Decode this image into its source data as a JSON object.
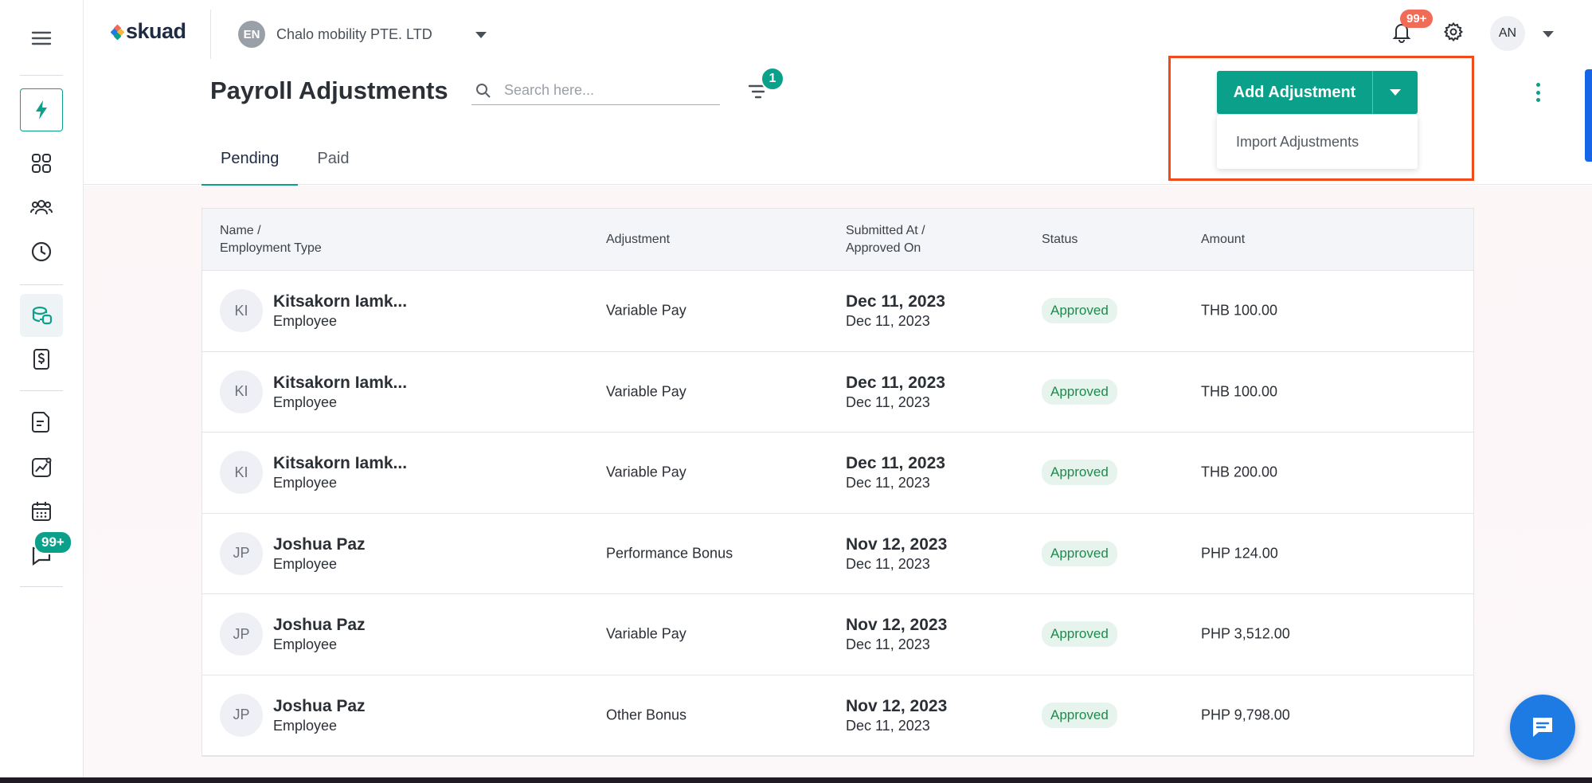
{
  "brand": {
    "logo_text": "skuad"
  },
  "org": {
    "avatar": "EN",
    "name": "Chalo mobility PTE. LTD"
  },
  "sidebar": {
    "message_badge": "99+"
  },
  "header": {
    "notification_badge": "99+",
    "user_initials": "AN"
  },
  "page": {
    "title": "Payroll Adjustments",
    "search_placeholder": "Search here...",
    "filter_count": "1"
  },
  "tabs": [
    {
      "label": "Pending"
    },
    {
      "label": "Paid"
    }
  ],
  "actions": {
    "add_label": "Add Adjustment",
    "menu_item": "Import Adjustments"
  },
  "table": {
    "headers": {
      "name_line1": "Name /",
      "name_line2": "Employment Type",
      "adjustment": "Adjustment",
      "submitted_line1": "Submitted At /",
      "submitted_line2": "Approved On",
      "status": "Status",
      "amount": "Amount"
    },
    "rows": [
      {
        "initials": "KI",
        "name": "Kitsakorn Iamk...",
        "type": "Employee",
        "adjustment": "Variable Pay",
        "submitted": "Dec 11, 2023",
        "approved": "Dec 11, 2023",
        "status": "Approved",
        "amount": "THB 100.00"
      },
      {
        "initials": "KI",
        "name": "Kitsakorn Iamk...",
        "type": "Employee",
        "adjustment": "Variable Pay",
        "submitted": "Dec 11, 2023",
        "approved": "Dec 11, 2023",
        "status": "Approved",
        "amount": "THB 100.00"
      },
      {
        "initials": "KI",
        "name": "Kitsakorn Iamk...",
        "type": "Employee",
        "adjustment": "Variable Pay",
        "submitted": "Dec 11, 2023",
        "approved": "Dec 11, 2023",
        "status": "Approved",
        "amount": "THB 200.00"
      },
      {
        "initials": "JP",
        "name": "Joshua Paz",
        "type": "Employee",
        "adjustment": "Performance Bonus",
        "submitted": "Nov 12, 2023",
        "approved": "Dec 11, 2023",
        "status": "Approved",
        "amount": "PHP 124.00"
      },
      {
        "initials": "JP",
        "name": "Joshua Paz",
        "type": "Employee",
        "adjustment": "Variable Pay",
        "submitted": "Nov 12, 2023",
        "approved": "Dec 11, 2023",
        "status": "Approved",
        "amount": "PHP 3,512.00"
      },
      {
        "initials": "JP",
        "name": "Joshua Paz",
        "type": "Employee",
        "adjustment": "Other Bonus",
        "submitted": "Nov 12, 2023",
        "approved": "Dec 11, 2023",
        "status": "Approved",
        "amount": "PHP 9,798.00"
      }
    ]
  },
  "colors": {
    "accent": "#0aa08a",
    "highlight": "#f04a1d",
    "badge": "#f26b57",
    "fab": "#1e7be3"
  }
}
